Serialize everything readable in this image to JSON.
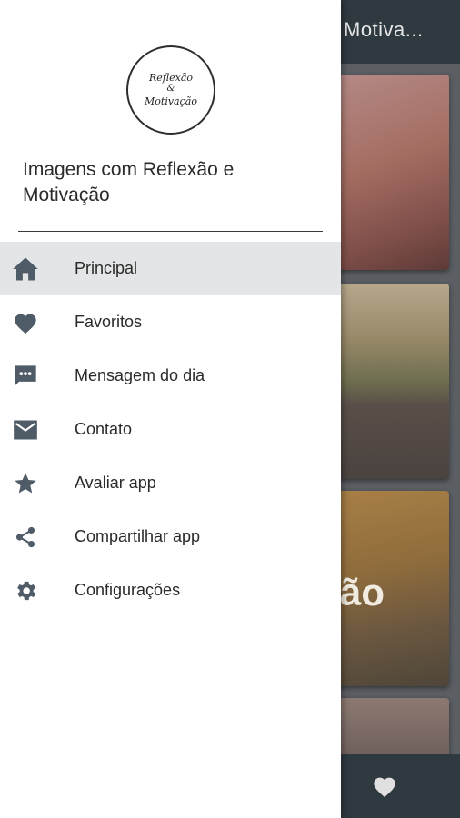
{
  "app": {
    "title": "Motiva...",
    "card_overlay_text": "ão"
  },
  "drawer": {
    "logo_lines": [
      "Reflexão",
      "&",
      "Motivação"
    ],
    "title": "Imagens com Reflexão e Motivação",
    "menu_items": [
      {
        "label": "Principal",
        "icon": "home-icon",
        "active": true
      },
      {
        "label": "Favoritos",
        "icon": "heart-icon",
        "active": false
      },
      {
        "label": "Mensagem do dia",
        "icon": "message-icon",
        "active": false
      },
      {
        "label": "Contato",
        "icon": "mail-icon",
        "active": false
      },
      {
        "label": "Avaliar app",
        "icon": "star-icon",
        "active": false
      },
      {
        "label": "Compartilhar app",
        "icon": "share-icon",
        "active": false
      },
      {
        "label": "Configurações",
        "icon": "gear-icon",
        "active": false
      }
    ]
  },
  "colors": {
    "app_bar": "#2f3a40",
    "icon": "#4f5b66",
    "active_item_bg": "#e3e5e7"
  }
}
